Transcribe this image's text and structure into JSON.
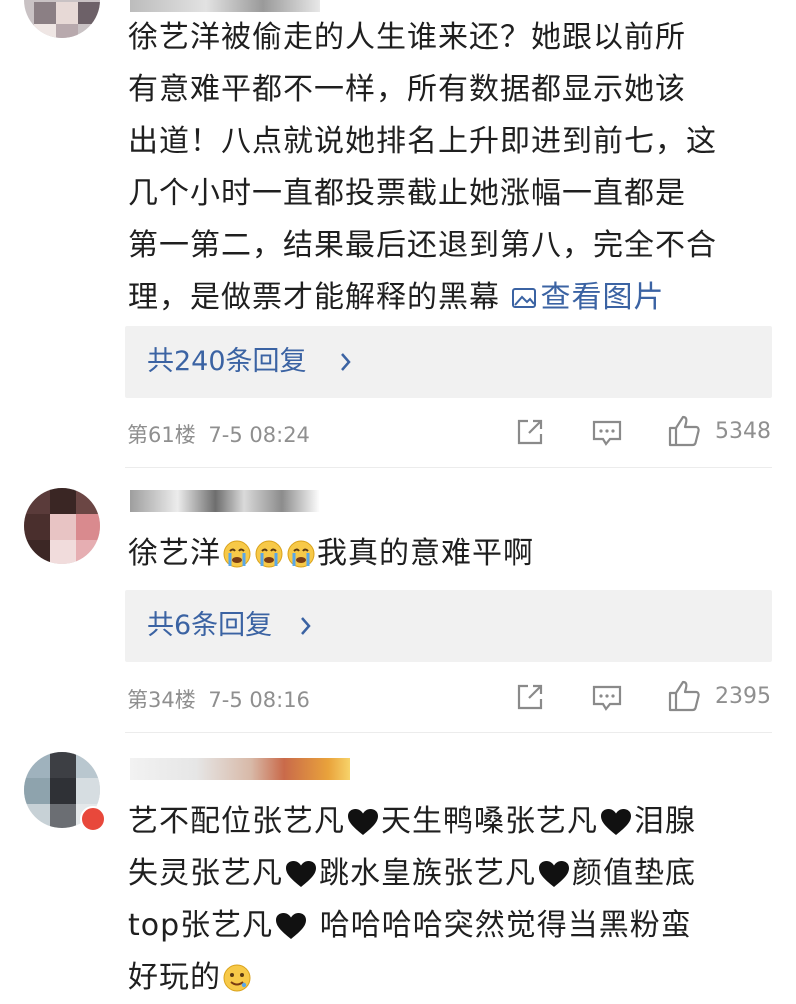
{
  "comments": [
    {
      "text_lines": [
        "徐艺洋被偷走的人生谁来还？她跟以前所",
        "有意难平都不一样，所有数据都显示她该",
        "出道！八点就说她排名上升即进到前七，这",
        "几个小时一直都投票截止她涨幅一直都是",
        "第一第二，结果最后还退到第八，完全不合",
        "理，是做票才能解释的黑幕"
      ],
      "view_image_label": "查看图片",
      "replies_label": "共240条回复",
      "floor": "第61楼",
      "time": "7-5 08:24",
      "likes": "5348"
    },
    {
      "text_prefix": "徐艺洋",
      "text_suffix": "我真的意难平啊",
      "replies_label": "共6条回复",
      "floor": "第34楼",
      "time": "7-5 08:16",
      "likes": "2395"
    },
    {
      "segments": [
        "艺不配位张艺凡",
        "天生鸭嗓张艺凡",
        "泪腺",
        "失灵张艺凡",
        "跳水皇族张艺凡",
        "颜值垫底",
        "top张艺凡",
        " 哈哈哈哈突然觉得当黑粉蛮",
        "好玩的"
      ],
      "icons": [
        "black-heart-icon",
        "crying-emoji-icon",
        "drooling-emoji-icon",
        "share-icon",
        "comment-icon",
        "thumbs-up-icon",
        "chevron-right-icon",
        "image-icon"
      ]
    }
  ],
  "colors": {
    "link": "#3b63a3",
    "meta": "#8f8f8f",
    "reply_bg": "#f1f1f1"
  }
}
